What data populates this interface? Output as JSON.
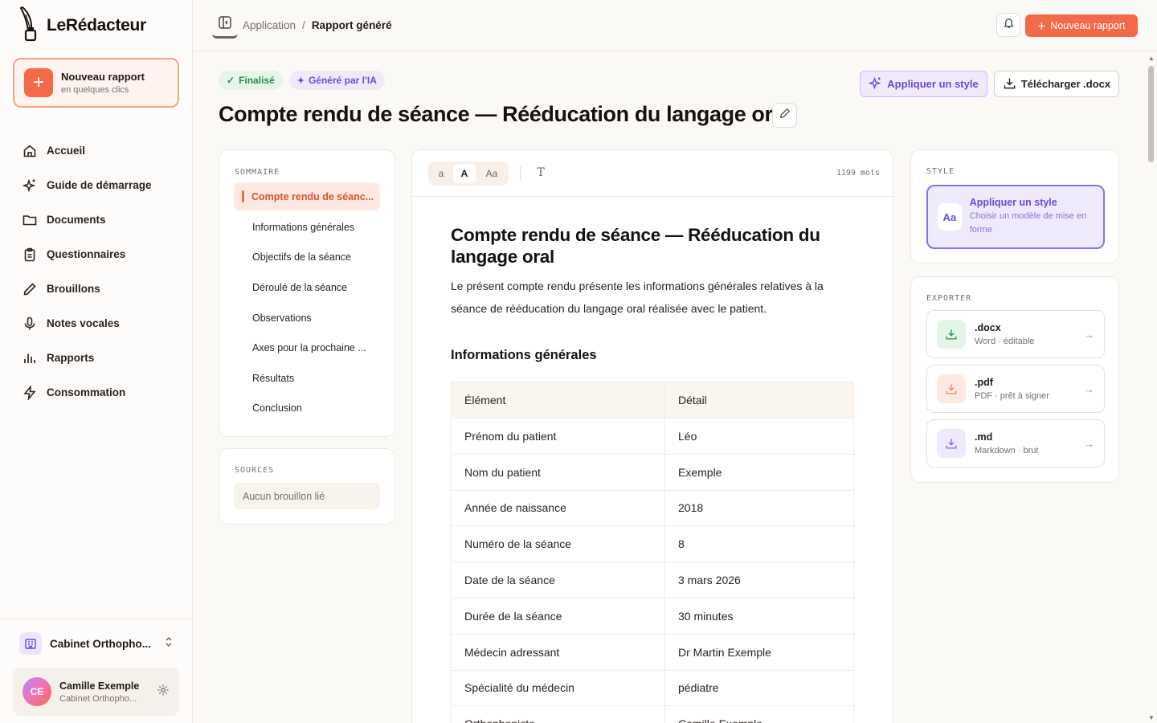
{
  "app": {
    "name": "LeRédacteur"
  },
  "sidebar": {
    "new_report": {
      "title": "Nouveau rapport",
      "subtitle": "en quelques clics"
    },
    "items": [
      {
        "label": "Accueil",
        "icon": "home-icon"
      },
      {
        "label": "Guide de démarrage",
        "icon": "sparkles-icon"
      },
      {
        "label": "Documents",
        "icon": "folder-icon"
      },
      {
        "label": "Questionnaires",
        "icon": "clipboard-icon"
      },
      {
        "label": "Brouillons",
        "icon": "pencil-icon"
      },
      {
        "label": "Notes vocales",
        "icon": "microphone-icon"
      },
      {
        "label": "Rapports",
        "icon": "bar-chart-icon"
      },
      {
        "label": "Consommation",
        "icon": "lightning-icon"
      }
    ],
    "org": {
      "name": "Cabinet Orthopho..."
    },
    "user": {
      "initials": "CE",
      "name": "Camille Exemple",
      "org": "Cabinet Orthopho..."
    }
  },
  "topbar": {
    "breadcrumb": {
      "parent": "Application",
      "separator": "/",
      "current": "Rapport généré"
    },
    "new_report_label": "Nouveau rapport"
  },
  "header": {
    "badges": {
      "status": "Finalisé",
      "ai": "Généré par l'IA"
    },
    "title": "Compte rendu de séance — Rééducation du langage oral",
    "apply_style_label": "Appliquer un style",
    "download_label": "Télécharger .docx"
  },
  "summary": {
    "label": "SOMMAIRE",
    "items": [
      "Compte rendu de séanc...",
      "Informations générales",
      "Objectifs de la séance",
      "Déroulé de la séance",
      "Observations",
      "Axes pour la prochaine ...",
      "Résultats",
      "Conclusion"
    ]
  },
  "sources": {
    "label": "SOURCES",
    "empty": "Aucun brouillon lié"
  },
  "editor": {
    "sizes": [
      "a",
      "A",
      "Aa"
    ],
    "font_button": "T",
    "word_count": "1199 mots",
    "title": "Compte rendu de séance — Rééducation du langage oral",
    "intro": "Le présent compte rendu présente les informations générales relatives à la séance de rééducation du langage oral réalisée avec le patient.",
    "section": "Informations générales",
    "table": {
      "headers": [
        "Élément",
        "Détail"
      ],
      "rows": [
        [
          "Prénom du patient",
          "Léo"
        ],
        [
          "Nom du patient",
          "Exemple"
        ],
        [
          "Année de naissance",
          "2018"
        ],
        [
          "Numéro de la séance",
          "8"
        ],
        [
          "Date de la séance",
          "3 mars 2026"
        ],
        [
          "Durée de la séance",
          "30 minutes"
        ],
        [
          "Médecin adressant",
          "Dr Martin Exemple"
        ],
        [
          "Spécialité du médecin",
          "pédiatre"
        ],
        [
          "Orthophoniste",
          "Camille Exemple"
        ]
      ]
    }
  },
  "style_panel": {
    "label": "STYLE",
    "icon_text": "Aa",
    "title": "Appliquer un style",
    "subtitle": "Choisir un modèle de mise en forme"
  },
  "export_panel": {
    "label": "EXPORTER",
    "items": [
      {
        "format": ".docx",
        "desc": "Word · éditable",
        "color": "#e3f4e8"
      },
      {
        "format": ".pdf",
        "desc": "PDF · prêt à signer",
        "color": "#fde9e1"
      },
      {
        "format": ".md",
        "desc": "Markdown · brut",
        "color": "#efe9fc"
      }
    ]
  },
  "colors": {
    "accent": "#f26a48",
    "purple": "#6d4ad8",
    "green": "#2f8a4a"
  }
}
